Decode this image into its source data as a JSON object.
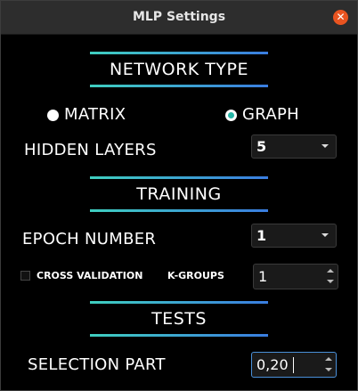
{
  "window": {
    "title": "MLP Settings"
  },
  "sections": {
    "network_type": "NETWORK TYPE",
    "training": "TRAINING",
    "tests": "TESTS"
  },
  "network_type": {
    "options": [
      {
        "label": "MATRIX",
        "selected": false
      },
      {
        "label": "GRAPH",
        "selected": true
      }
    ]
  },
  "hidden_layers": {
    "label": "HIDDEN LAYERS",
    "value": "5"
  },
  "epoch_number": {
    "label": "EPOCH NUMBER",
    "value": "1"
  },
  "cross_validation": {
    "label": "CROSS VALIDATION",
    "checked": false
  },
  "k_groups": {
    "label": "K-GROUPS",
    "value": "1"
  },
  "selection_part": {
    "label": "SELECTION PART",
    "value": "0,20"
  },
  "colors": {
    "accent_teal": "#3fcfc0",
    "accent_blue": "#3a7de0",
    "close": "#e95420"
  }
}
